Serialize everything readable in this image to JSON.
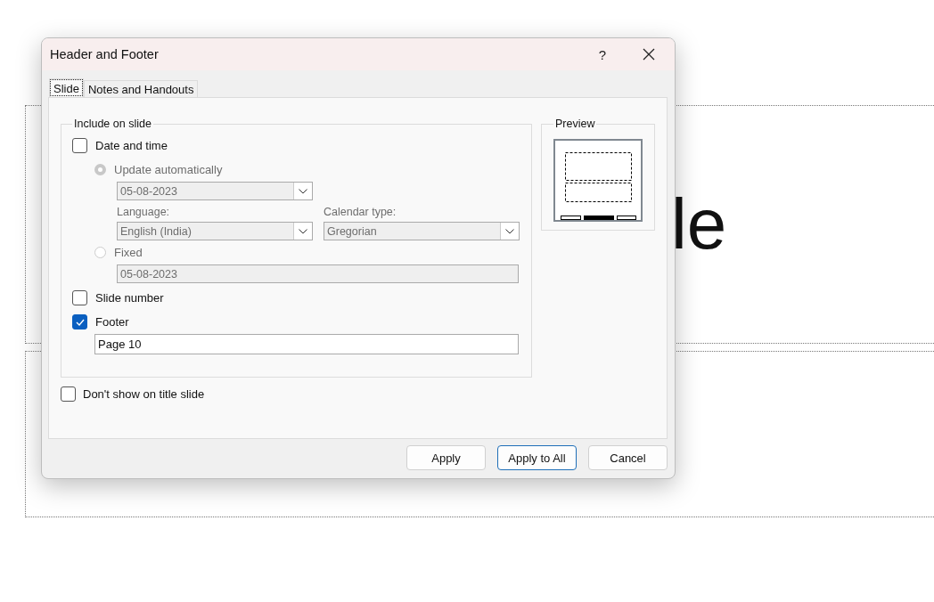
{
  "slide": {
    "title_fragment": "le"
  },
  "window": {
    "title": "Header and Footer",
    "help": "?"
  },
  "tabs": [
    {
      "label": "Slide",
      "selected": true
    },
    {
      "label": "Notes and Handouts",
      "selected": false
    }
  ],
  "include_group": {
    "title": "Include on slide",
    "date_and_time": {
      "label": "Date and time",
      "checked": false
    },
    "update_automatically": {
      "label": "Update automatically",
      "selected": true,
      "disabled": true
    },
    "date_dropdown": {
      "value": "05-08-2023",
      "disabled": true
    },
    "language": {
      "label": "Language:",
      "value": "English (India)",
      "disabled": true
    },
    "calendar_type": {
      "label": "Calendar type:",
      "value": "Gregorian",
      "disabled": true
    },
    "fixed": {
      "label": "Fixed",
      "selected": false,
      "disabled": true
    },
    "fixed_date": {
      "value": "05-08-2023",
      "disabled": true
    },
    "slide_number": {
      "label": "Slide number",
      "checked": false
    },
    "footer": {
      "label": "Footer",
      "checked": true
    },
    "footer_text": {
      "value": "Page 10"
    }
  },
  "dont_show_on_title_slide": {
    "label": "Don't show on title slide",
    "checked": false
  },
  "preview": {
    "title": "Preview"
  },
  "buttons": [
    {
      "label": "Apply",
      "default": false
    },
    {
      "label": "Apply to All",
      "default": true
    },
    {
      "label": "Cancel",
      "default": false
    }
  ]
}
